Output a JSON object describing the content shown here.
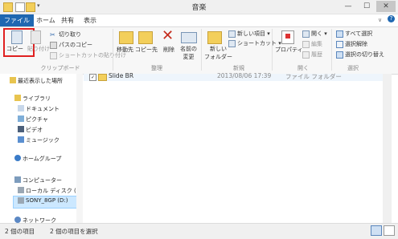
{
  "window": {
    "title": "音楽",
    "minimize": "—",
    "maximize": "☐",
    "close": "✕"
  },
  "tabs": {
    "file": "ファイル",
    "home": "ホーム",
    "share": "共有",
    "view": "表示"
  },
  "ribbon": {
    "clipboard": {
      "copy": "コピー",
      "paste": "貼り付け",
      "cut": "切り取り",
      "copy_path": "パスのコピー",
      "paste_shortcut": "ショートカットの貼り付け",
      "group": "クリップボード"
    },
    "organize": {
      "move_to": "移動先",
      "copy_to": "コピー先",
      "delete": "削除",
      "rename_1": "名前の",
      "rename_2": "変更",
      "group": "整理"
    },
    "new": {
      "new_folder_1": "新しい",
      "new_folder_2": "フォルダー",
      "new_item": "新しい項目",
      "shortcut": "ショートカット",
      "group": "新規"
    },
    "open": {
      "properties": "プロパティ",
      "open": "開く",
      "edit": "編集",
      "history": "履歴",
      "group": "開く"
    },
    "select": {
      "select_all": "すべて選択",
      "select_none": "選択解除",
      "invert": "選択の切り替え",
      "group": "選択"
    }
  },
  "nav": {
    "recent": "最近表示した場所",
    "libraries": "ライブラリ",
    "documents": "ドキュメント",
    "pictures": "ピクチャ",
    "videos": "ビデオ",
    "music": "ミュージック",
    "homegroup": "ホームグループ",
    "computer": "コンピューター",
    "local_disk": "ローカル ディスク (C",
    "sony": "SONY_8GP (D:)",
    "network": "ネットワーク"
  },
  "file_row": {
    "name": "Slide BR",
    "date": "2013/08/06 17:39",
    "type": "ファイル フォルダー"
  },
  "status": {
    "items": "2 個の項目",
    "selected": "2 個の項目を選択"
  },
  "colors": {
    "file_tab": "#1f67b1",
    "highlight": "#e02020",
    "selection": "#cce8ff"
  }
}
